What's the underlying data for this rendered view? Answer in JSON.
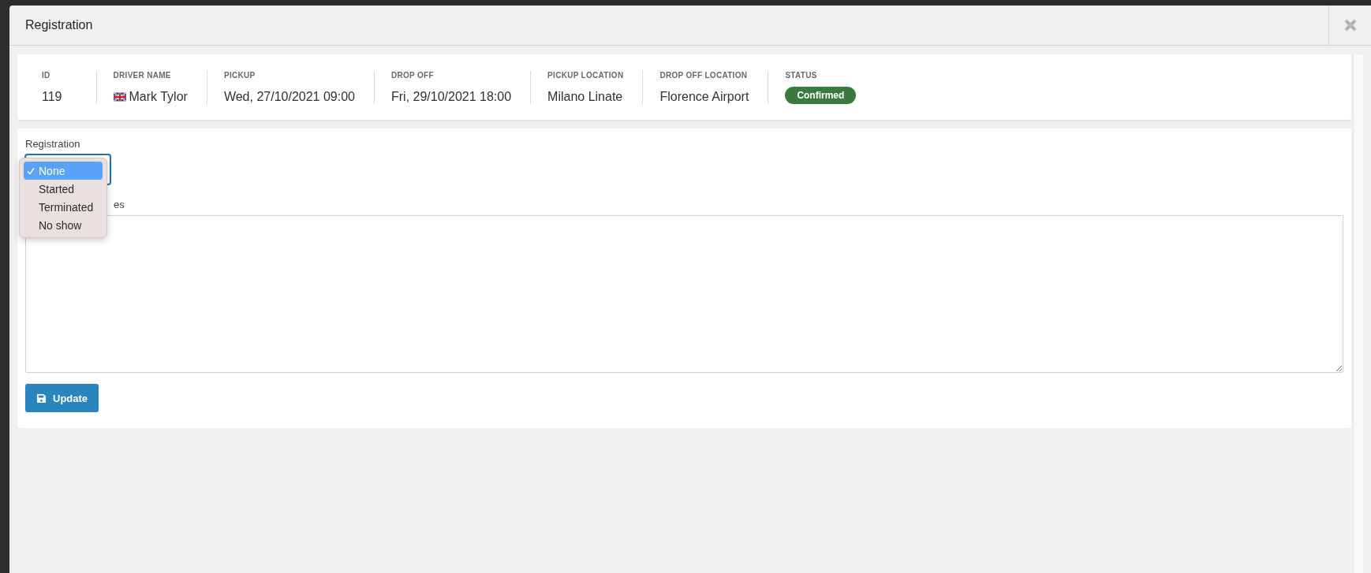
{
  "dialog": {
    "title": "Registration"
  },
  "summary": [
    {
      "label": "ID",
      "value": "119",
      "kind": "text"
    },
    {
      "label": "DRIVER NAME",
      "value": "Mark Tylor",
      "kind": "driver"
    },
    {
      "label": "PICKUP",
      "value": "Wed, 27/10/2021 09:00",
      "kind": "text"
    },
    {
      "label": "DROP OFF",
      "value": "Fri, 29/10/2021 18:00",
      "kind": "text"
    },
    {
      "label": "PICKUP LOCATION",
      "value": "Milano Linate",
      "kind": "text"
    },
    {
      "label": "DROP OFF LOCATION",
      "value": "Florence Airport",
      "kind": "text"
    },
    {
      "label": "STATUS",
      "value": "Confirmed",
      "kind": "badge"
    }
  ],
  "form": {
    "registration_label": "Registration",
    "registration_options": [
      {
        "label": "None",
        "selected": true
      },
      {
        "label": "Started",
        "selected": false
      },
      {
        "label": "Terminated",
        "selected": false
      },
      {
        "label": "No show",
        "selected": false
      }
    ],
    "notes_label": "es",
    "update_button": "Update"
  }
}
